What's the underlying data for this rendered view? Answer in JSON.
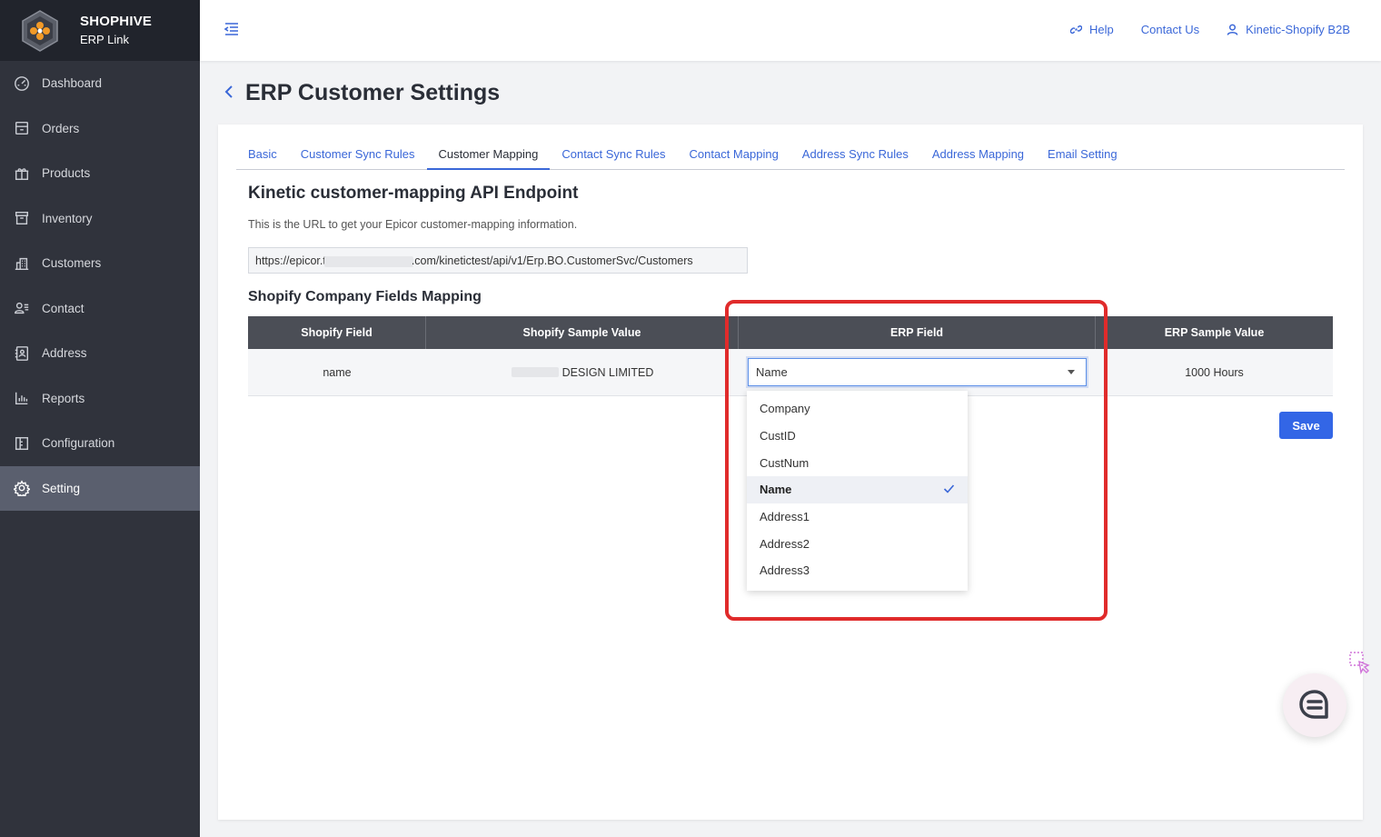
{
  "brand": {
    "title": "SHOPHIVE",
    "subtitle": "ERP Link"
  },
  "sidebar": {
    "items": [
      {
        "label": "Dashboard",
        "icon": "dashboard-icon"
      },
      {
        "label": "Orders",
        "icon": "orders-icon"
      },
      {
        "label": "Products",
        "icon": "products-icon"
      },
      {
        "label": "Inventory",
        "icon": "inventory-icon"
      },
      {
        "label": "Customers",
        "icon": "customers-icon"
      },
      {
        "label": "Contact",
        "icon": "contact-icon"
      },
      {
        "label": "Address",
        "icon": "address-icon"
      },
      {
        "label": "Reports",
        "icon": "reports-icon"
      },
      {
        "label": "Configuration",
        "icon": "configuration-icon"
      },
      {
        "label": "Setting",
        "icon": "setting-icon",
        "active": true
      }
    ]
  },
  "header": {
    "help": "Help",
    "contact_us": "Contact Us",
    "account": "Kinetic-Shopify B2B"
  },
  "page": {
    "title": "ERP Customer Settings"
  },
  "tabs": [
    {
      "label": "Basic"
    },
    {
      "label": "Customer Sync Rules"
    },
    {
      "label": "Customer Mapping",
      "active": true
    },
    {
      "label": "Contact Sync Rules"
    },
    {
      "label": "Contact Mapping"
    },
    {
      "label": "Address Sync Rules"
    },
    {
      "label": "Address Mapping"
    },
    {
      "label": "Email Setting"
    }
  ],
  "endpoint": {
    "title": "Kinetic customer-mapping API Endpoint",
    "description": "This is the URL to get your Epicor customer-mapping information.",
    "url_prefix": "https://epicor.t",
    "url_suffix": ".com/kinetictest/api/v1/Erp.BO.CustomerSvc/Customers"
  },
  "mapping": {
    "title": "Shopify Company Fields Mapping",
    "columns": [
      "Shopify Field",
      "Shopify Sample Value",
      "ERP Field",
      "ERP Sample Value"
    ],
    "row": {
      "shopify_field": "name",
      "shopify_sample": "DESIGN LIMITED",
      "erp_field": "Name",
      "erp_sample": "1000 Hours"
    },
    "options": [
      "Company",
      "CustID",
      "CustNum",
      "Name",
      "Address1",
      "Address2",
      "Address3"
    ],
    "selected_option": "Name"
  },
  "actions": {
    "save": "Save"
  },
  "colors": {
    "accent": "#3a67d8",
    "highlight": "#e02b2b",
    "sidebar": "#30333c"
  }
}
